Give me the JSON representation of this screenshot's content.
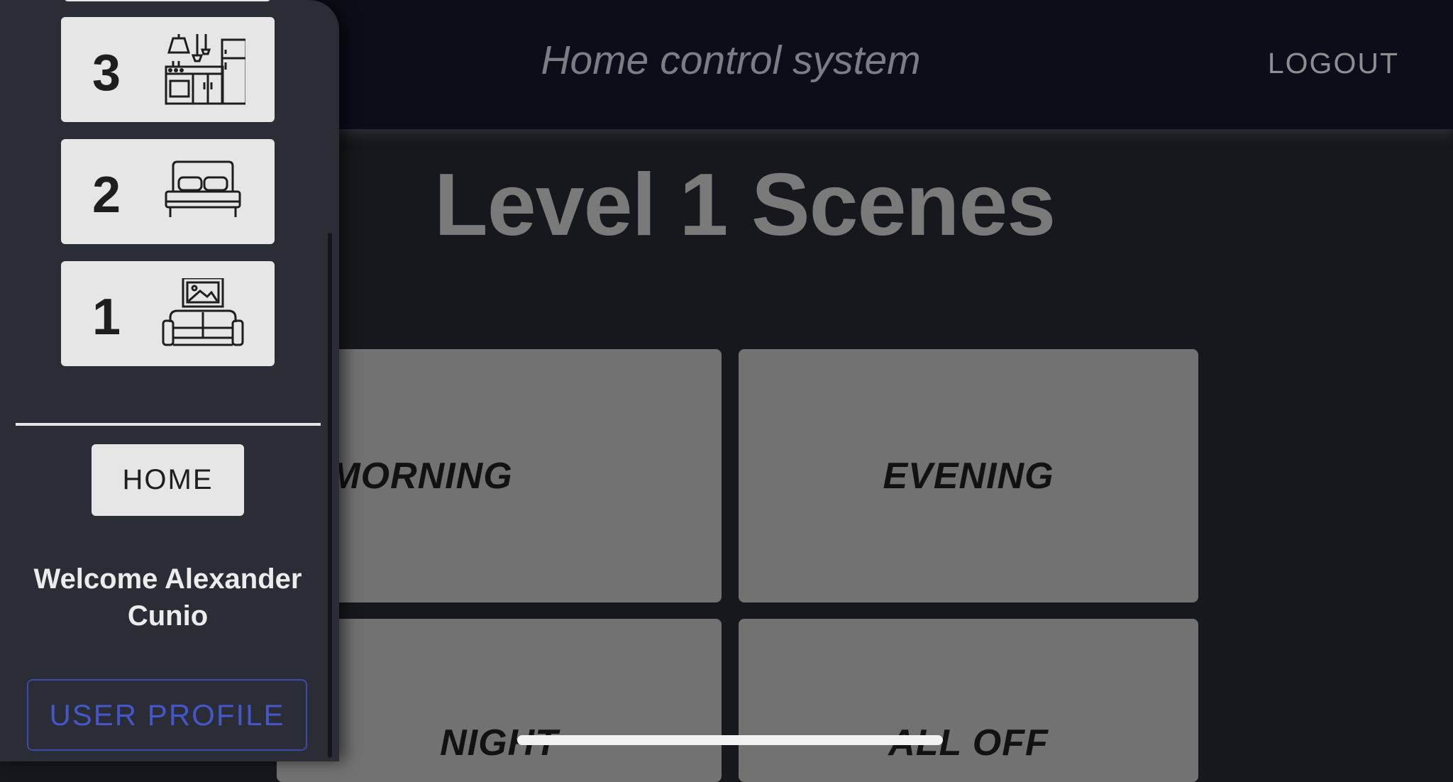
{
  "header": {
    "title": "Home control system",
    "logout_label": "LOGOUT"
  },
  "main": {
    "page_title": "Level 1 Scenes",
    "scenes": [
      {
        "label": "MORNING"
      },
      {
        "label": "EVENING"
      },
      {
        "label": "NIGHT"
      },
      {
        "label": "ALL OFF"
      }
    ]
  },
  "sidebar": {
    "levels": [
      {
        "number": "3",
        "icon": "kitchen-icon"
      },
      {
        "number": "2",
        "icon": "bed-icon"
      },
      {
        "number": "1",
        "icon": "living-room-icon"
      }
    ],
    "home_label": "HOME",
    "welcome_text": "Welcome Alexander Cunio",
    "profile_label": "USER PROFILE"
  },
  "colors": {
    "background": "#17181d",
    "header_bg": "#0b0d19",
    "sidebar_bg": "#2a2c36",
    "tile_bg": "#727272",
    "accent_blue": "#4456c8"
  }
}
